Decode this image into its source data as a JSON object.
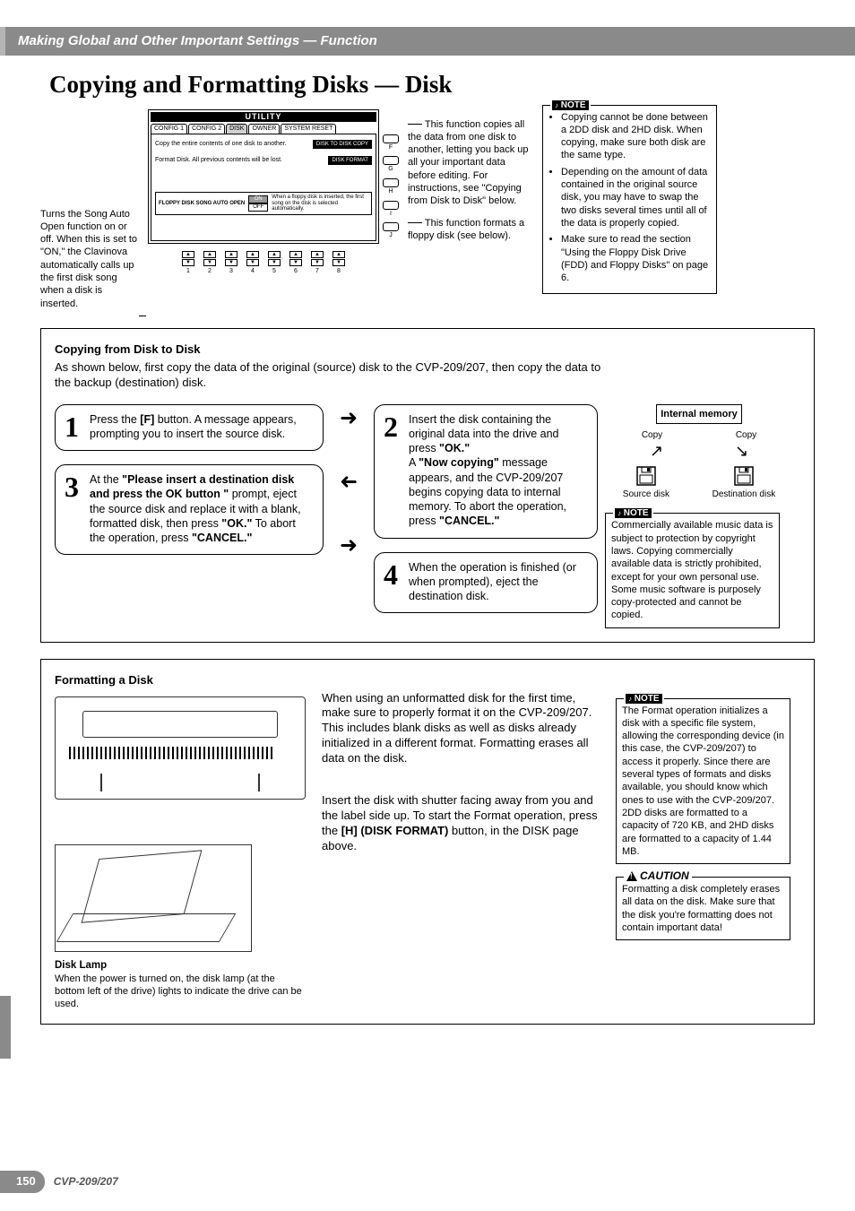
{
  "header": {
    "chapter": "Making Global and Other Important Settings — Function"
  },
  "title": "Copying and Formatting Disks — Disk",
  "leftNote": "Turns the Song Auto Open function on or off. When this is set to \"ON,\" the Clavinova automatically calls up the first disk song when a disk is inserted.",
  "utility": {
    "title": "UTILITY",
    "tabs": [
      "CONFIG 1",
      "CONFIG 2",
      "DISK",
      "OWNER",
      "SYSTEM RESET"
    ],
    "row1_text": "Copy the entire contents of one disk to another.",
    "row1_btn": "DISK TO DISK COPY",
    "row2_text": "Format Disk. All previous contents will be lost.",
    "row2_btn": "DISK FORMAT",
    "auto_open_label": "FLOPPY DISK SONG AUTO OPEN",
    "auto_open_on": "ON",
    "auto_open_off": "OFF",
    "auto_open_desc": "When a floppy disk is inserted, the first song on the disk is selected automatically.",
    "side_labels": [
      "F",
      "G",
      "H",
      "I",
      "J"
    ],
    "bottom_nums": [
      "1",
      "2",
      "3",
      "4",
      "5",
      "6",
      "7",
      "8"
    ]
  },
  "rightDesc": {
    "p1": "This function copies all the data from one disk to another, letting you back up all your important data before editing. For instructions, see \"Copying from Disk to Disk\" below.",
    "p2": "This function formats a floppy disk (see below)."
  },
  "noteTop": {
    "label": "NOTE",
    "items": [
      "Copying cannot be done between a 2DD disk and 2HD disk. When copying, make sure both disk are the same type.",
      "Depending on the amount of data contained in the original source disk, you may have to swap the two disks several times until all of the data is properly copied.",
      "Make sure to read the section \"Using the Floppy Disk Drive (FDD) and Floppy Disks\" on page 6."
    ]
  },
  "copySection": {
    "title": "Copying from Disk to Disk",
    "intro": "As shown below, first copy the data of the original (source) disk to the CVP-209/207, then copy the data to the backup (destination) disk.",
    "step1_pre": "Press the ",
    "step1_bold1": "[F]",
    "step1_post": " button. A message appears, prompting you to insert the source disk.",
    "step2_a": "Insert the disk containing the original data into the drive and press ",
    "step2_ok": "\"OK.\"",
    "step2_b": "A ",
    "step2_now": "\"Now copying\"",
    "step2_c": " message appears, and the CVP-209/207 begins copying data to internal memory. To abort the operation, press ",
    "step2_cancel": "\"CANCEL.\"",
    "step3_a": "At the ",
    "step3_bold": "\"Please insert a destination disk and press the OK button \"",
    "step3_b": " prompt, eject the source disk and replace it with a blank, formatted disk, then press ",
    "step3_ok": "\"OK.\"",
    "step3_c": " To abort the operation, press ",
    "step3_cancel": "\"CANCEL.\"",
    "step4": "When the operation is finished (or when prompted), eject the destination disk.",
    "diagram": {
      "internal": "Internal memory",
      "copy": "Copy",
      "source": "Source disk",
      "dest": "Destination disk"
    },
    "note": {
      "label": "NOTE",
      "text": "Commercially available music data is subject to protection by copyright laws. Copying commercially available data is strictly prohibited, except for your own personal use. Some music software is purposely copy-protected and cannot be copied."
    }
  },
  "formatSection": {
    "title": "Formatting a Disk",
    "p1_a": "When using an unformatted disk for the first time, make sure to properly format it on the CVP-209/207. This includes blank disks as well as disks already initialized in a different format. Formatting erases all data on the disk.",
    "p2_a": "Insert the disk with shutter facing away from you and the label side up. To start the Format operation, press the ",
    "p2_bold": "[H] (DISK FORMAT)",
    "p2_b": " button, in the DISK page above.",
    "diskLampTitle": "Disk Lamp",
    "diskLampDesc": "When the power is turned on, the disk lamp (at the bottom left of the drive) lights to indicate the drive can be used.",
    "note": {
      "label": "NOTE",
      "text": "The Format operation initializes a disk with a specific file system, allowing the corresponding device (in this case, the CVP-209/207) to access it properly. Since there are several types of formats and disks available, you should know which ones to use with the CVP-209/207. 2DD disks are formatted to a capacity of 720 KB, and 2HD disks are formatted to a capacity of 1.44 MB."
    },
    "caution": {
      "label": "CAUTION",
      "text": "Formatting a disk completely erases all data on the disk. Make sure that the disk you're formatting does not contain important data!"
    }
  },
  "footer": {
    "page": "150",
    "model": "CVP-209/207"
  }
}
